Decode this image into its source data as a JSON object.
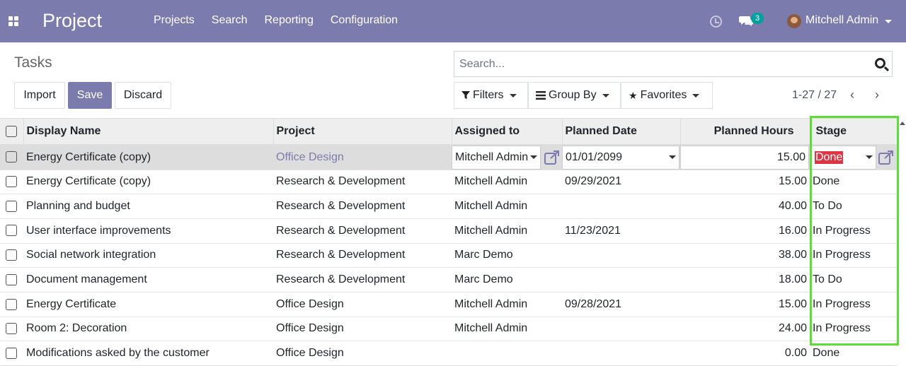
{
  "app": {
    "title": "Project"
  },
  "menu": [
    "Projects",
    "Search",
    "Reporting",
    "Configuration"
  ],
  "topbar": {
    "messages_count": "3",
    "user_name": "Mitchell Admin"
  },
  "breadcrumb": "Tasks",
  "buttons": {
    "import": "Import",
    "save": "Save",
    "discard": "Discard"
  },
  "search": {
    "placeholder": "Search..."
  },
  "filters": {
    "filters": "Filters",
    "group_by": "Group By",
    "favorites": "Favorites"
  },
  "pager": {
    "text": "1-27 / 27"
  },
  "table": {
    "headers": [
      "Display Name",
      "Project",
      "Assigned to",
      "Planned Date",
      "Planned Hours",
      "Stage"
    ],
    "rows": [
      {
        "name": "Energy Certificate (copy)",
        "project": "Office Design",
        "assigned": "Mitchell Admin",
        "date": "01/01/2099",
        "hours": "15.00",
        "stage": "Done"
      },
      {
        "name": "Energy Certificate (copy)",
        "project": "Research & Development",
        "assigned": "Mitchell Admin",
        "date": "09/29/2021",
        "hours": "15.00",
        "stage": "Done"
      },
      {
        "name": "Planning and budget",
        "project": "Research & Development",
        "assigned": "Mitchell Admin",
        "date": "",
        "hours": "40.00",
        "stage": "To Do"
      },
      {
        "name": "User interface improvements",
        "project": "Research & Development",
        "assigned": "Mitchell Admin",
        "date": "11/23/2021",
        "hours": "16.00",
        "stage": "In Progress"
      },
      {
        "name": "Social network integration",
        "project": "Research & Development",
        "assigned": "Marc Demo",
        "date": "",
        "hours": "38.00",
        "stage": "In Progress"
      },
      {
        "name": "Document management",
        "project": "Research & Development",
        "assigned": "Marc Demo",
        "date": "",
        "hours": "18.00",
        "stage": "To Do"
      },
      {
        "name": "Energy Certificate",
        "project": "Office Design",
        "assigned": "Mitchell Admin",
        "date": "09/28/2021",
        "hours": "15.00",
        "stage": "In Progress"
      },
      {
        "name": "Room 2: Decoration",
        "project": "Office Design",
        "assigned": "Mitchell Admin",
        "date": "",
        "hours": "24.00",
        "stage": "In Progress"
      },
      {
        "name": "Modifications asked by the customer",
        "project": "Office Design",
        "assigned": "",
        "date": "",
        "hours": "0.00",
        "stage": "Done"
      }
    ]
  },
  "colors": {
    "brand": "#7c7bad",
    "badge": "#00a09d",
    "highlight": "#5ddc3a",
    "done_selected": "#dc3545"
  }
}
